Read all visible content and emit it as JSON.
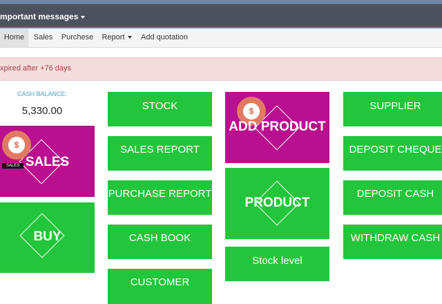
{
  "topbar": {
    "menu_label": "mportant messages"
  },
  "nav": {
    "items": [
      "Home",
      "Sales",
      "Purchese",
      "Report",
      "Add quotation"
    ]
  },
  "alert": {
    "text": "xpired after +76 days"
  },
  "cash": {
    "label": "CASH BALANCE:",
    "value": "5,330.00"
  },
  "tiles": {
    "sales": "SALES",
    "sales_banner": "SALES",
    "buy": "BUY",
    "stock": "STOCK",
    "sales_report": "SALES REPORT",
    "purchase_report": "PURCHASE REPORT",
    "cash_book": "CASH BOOK",
    "customer": "CUSTOMER",
    "add_product": "ADD PRODUCT",
    "product": "PRODUCT",
    "stock_level": "Stock level",
    "supplier": "SUPPLIER",
    "deposit_cheque": "DEPOSIT CHEQUE",
    "deposit_cash": "DEPOSIT CASH",
    "withdraw_cash": "WITHDRAW CASH"
  },
  "colors": {
    "tile_green": "#22c53b",
    "tile_purple": "#b9108f",
    "topbar": "#4d5260",
    "alert_bg": "#f3dcdc",
    "alert_text": "#a94442"
  },
  "icons": {
    "money_bag": "money-bag-icon",
    "diamond": "diamond-outline-icon"
  }
}
